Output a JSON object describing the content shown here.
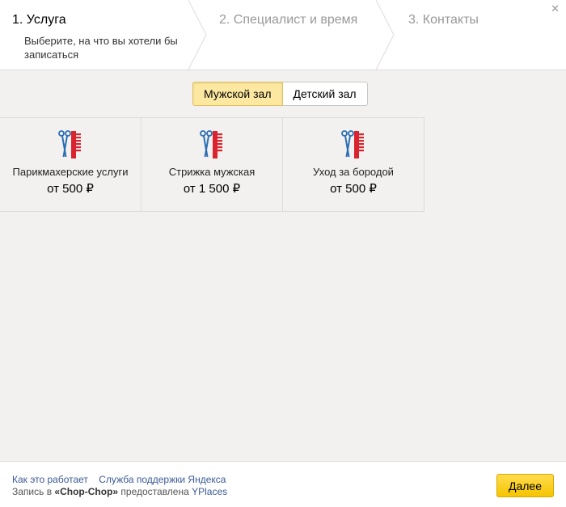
{
  "steps": [
    {
      "title": "1. Услуга",
      "subtitle": "Выберите, на что вы хотели бы записаться"
    },
    {
      "title": "2. Специалист и время"
    },
    {
      "title": "3. Контакты"
    }
  ],
  "close_glyph": "✕",
  "halls": {
    "men": "Мужской зал",
    "kids": "Детский зал",
    "selected": "Мужской зал"
  },
  "services": [
    {
      "name": "Парикмахерские услуги",
      "price": "от 500 ₽",
      "icon": "scissors-comb-icon"
    },
    {
      "name": "Стрижка мужская",
      "price": "от 1 500 ₽",
      "icon": "scissors-comb-icon"
    },
    {
      "name": "Уход за бородой",
      "price": "от 500 ₽",
      "icon": "scissors-comb-icon"
    }
  ],
  "footer": {
    "how_it_works": "Как это работает",
    "support": "Служба поддержки Яндекса",
    "credit_prefix": "Запись в ",
    "credit_name": "«Chop-Chop»",
    "credit_middle": " предоставлена ",
    "credit_provider": "YPlaces",
    "next_label": "Далее"
  },
  "colors": {
    "accent_yellow": "#f5c400",
    "selected_hall": "#fde8a1",
    "icon_red": "#d9232e",
    "icon_blue": "#2a6db5",
    "link": "#3a5a98"
  }
}
